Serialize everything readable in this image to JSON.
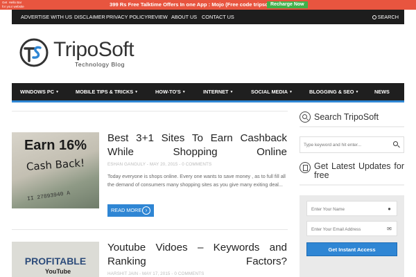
{
  "hellobar": {
    "tag": "Get  Hello Bar\nfor your website",
    "text": "399 Rs Free Talktime Offers In one App : Mojo (Free code tripsoft",
    "button": "Recharge Now"
  },
  "topnav": {
    "items": [
      "ADVERTISE WITH US",
      "DISCLAIMER",
      "PRIVACY POLICY",
      "REVIEW",
      "ABOUT US",
      "CONTACT US"
    ],
    "search": "SEARCH"
  },
  "logo": {
    "name": "TripoSoft",
    "tagline": "Technology Blog"
  },
  "mainnav": {
    "items": [
      "WINDOWS PC",
      "MOBILE TIPS & TRICKS",
      "HOW-TO'S",
      "INTERNET",
      "SOCIAL MEDIA",
      "BLOGGING & SEO",
      "NEWS"
    ]
  },
  "posts": [
    {
      "thumb_line1": "Earn 16%",
      "thumb_line2": "Cash Back!",
      "thumb_serial": "II 27893940 A",
      "title": "Best 3+1 Sites To Earn Cashback While Shopping Online",
      "meta": "ESHAN GANGULY - MAY 20, 2015 - 0 COMMENTS",
      "excerpt": "Today everyone is shops online. Every one wants to save money , as to full fill all the demand of consumers many shopping sites as you give many exiting deal...",
      "readmore": "READ MORE"
    },
    {
      "thumb_line1": "PROFITABLE",
      "thumb_line2": "YouTube",
      "title": "Youtube Vidoes – Keywords and Ranking Factors?",
      "meta": "HARSHIT JAIN - MAY 17, 2015 - 0 COMMENTS"
    }
  ],
  "sidebar": {
    "search_title": "Search TripoSoft",
    "search_placeholder": "Type keyword and hit enter...",
    "updates_title": "Get Latest Updates for free",
    "name_placeholder": "Enter Your Name",
    "email_placeholder": "Enter Your Email Address",
    "button": "Get Instant Access"
  },
  "colors": {
    "accent": "#2f86d4",
    "hellobar": "#e8553f",
    "recharge": "#3fb14a",
    "nav": "#1f1f1f"
  }
}
